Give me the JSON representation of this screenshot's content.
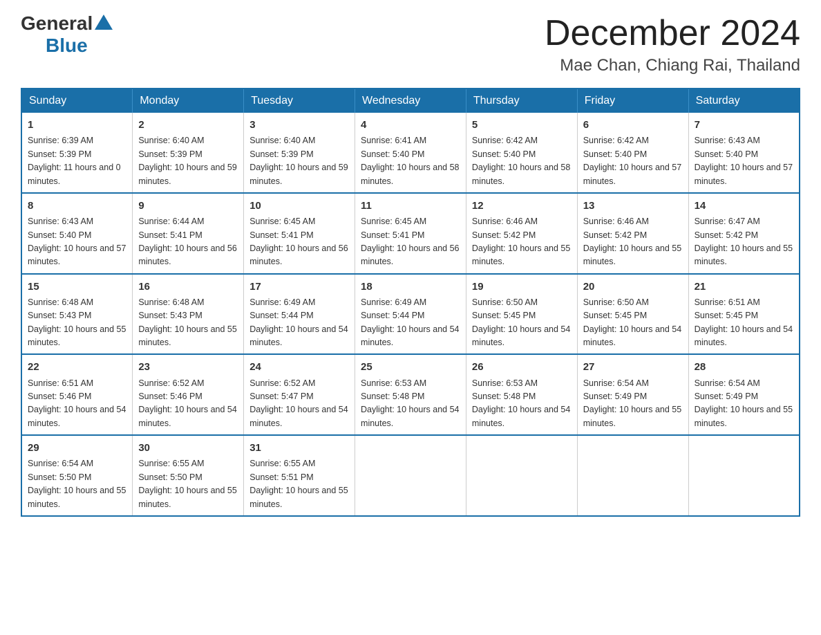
{
  "header": {
    "logo_general": "General",
    "logo_blue": "Blue",
    "month_title": "December 2024",
    "location": "Mae Chan, Chiang Rai, Thailand"
  },
  "weekdays": [
    "Sunday",
    "Monday",
    "Tuesday",
    "Wednesday",
    "Thursday",
    "Friday",
    "Saturday"
  ],
  "weeks": [
    [
      {
        "day": "1",
        "sunrise": "Sunrise: 6:39 AM",
        "sunset": "Sunset: 5:39 PM",
        "daylight": "Daylight: 11 hours and 0 minutes."
      },
      {
        "day": "2",
        "sunrise": "Sunrise: 6:40 AM",
        "sunset": "Sunset: 5:39 PM",
        "daylight": "Daylight: 10 hours and 59 minutes."
      },
      {
        "day": "3",
        "sunrise": "Sunrise: 6:40 AM",
        "sunset": "Sunset: 5:39 PM",
        "daylight": "Daylight: 10 hours and 59 minutes."
      },
      {
        "day": "4",
        "sunrise": "Sunrise: 6:41 AM",
        "sunset": "Sunset: 5:40 PM",
        "daylight": "Daylight: 10 hours and 58 minutes."
      },
      {
        "day": "5",
        "sunrise": "Sunrise: 6:42 AM",
        "sunset": "Sunset: 5:40 PM",
        "daylight": "Daylight: 10 hours and 58 minutes."
      },
      {
        "day": "6",
        "sunrise": "Sunrise: 6:42 AM",
        "sunset": "Sunset: 5:40 PM",
        "daylight": "Daylight: 10 hours and 57 minutes."
      },
      {
        "day": "7",
        "sunrise": "Sunrise: 6:43 AM",
        "sunset": "Sunset: 5:40 PM",
        "daylight": "Daylight: 10 hours and 57 minutes."
      }
    ],
    [
      {
        "day": "8",
        "sunrise": "Sunrise: 6:43 AM",
        "sunset": "Sunset: 5:40 PM",
        "daylight": "Daylight: 10 hours and 57 minutes."
      },
      {
        "day": "9",
        "sunrise": "Sunrise: 6:44 AM",
        "sunset": "Sunset: 5:41 PM",
        "daylight": "Daylight: 10 hours and 56 minutes."
      },
      {
        "day": "10",
        "sunrise": "Sunrise: 6:45 AM",
        "sunset": "Sunset: 5:41 PM",
        "daylight": "Daylight: 10 hours and 56 minutes."
      },
      {
        "day": "11",
        "sunrise": "Sunrise: 6:45 AM",
        "sunset": "Sunset: 5:41 PM",
        "daylight": "Daylight: 10 hours and 56 minutes."
      },
      {
        "day": "12",
        "sunrise": "Sunrise: 6:46 AM",
        "sunset": "Sunset: 5:42 PM",
        "daylight": "Daylight: 10 hours and 55 minutes."
      },
      {
        "day": "13",
        "sunrise": "Sunrise: 6:46 AM",
        "sunset": "Sunset: 5:42 PM",
        "daylight": "Daylight: 10 hours and 55 minutes."
      },
      {
        "day": "14",
        "sunrise": "Sunrise: 6:47 AM",
        "sunset": "Sunset: 5:42 PM",
        "daylight": "Daylight: 10 hours and 55 minutes."
      }
    ],
    [
      {
        "day": "15",
        "sunrise": "Sunrise: 6:48 AM",
        "sunset": "Sunset: 5:43 PM",
        "daylight": "Daylight: 10 hours and 55 minutes."
      },
      {
        "day": "16",
        "sunrise": "Sunrise: 6:48 AM",
        "sunset": "Sunset: 5:43 PM",
        "daylight": "Daylight: 10 hours and 55 minutes."
      },
      {
        "day": "17",
        "sunrise": "Sunrise: 6:49 AM",
        "sunset": "Sunset: 5:44 PM",
        "daylight": "Daylight: 10 hours and 54 minutes."
      },
      {
        "day": "18",
        "sunrise": "Sunrise: 6:49 AM",
        "sunset": "Sunset: 5:44 PM",
        "daylight": "Daylight: 10 hours and 54 minutes."
      },
      {
        "day": "19",
        "sunrise": "Sunrise: 6:50 AM",
        "sunset": "Sunset: 5:45 PM",
        "daylight": "Daylight: 10 hours and 54 minutes."
      },
      {
        "day": "20",
        "sunrise": "Sunrise: 6:50 AM",
        "sunset": "Sunset: 5:45 PM",
        "daylight": "Daylight: 10 hours and 54 minutes."
      },
      {
        "day": "21",
        "sunrise": "Sunrise: 6:51 AM",
        "sunset": "Sunset: 5:45 PM",
        "daylight": "Daylight: 10 hours and 54 minutes."
      }
    ],
    [
      {
        "day": "22",
        "sunrise": "Sunrise: 6:51 AM",
        "sunset": "Sunset: 5:46 PM",
        "daylight": "Daylight: 10 hours and 54 minutes."
      },
      {
        "day": "23",
        "sunrise": "Sunrise: 6:52 AM",
        "sunset": "Sunset: 5:46 PM",
        "daylight": "Daylight: 10 hours and 54 minutes."
      },
      {
        "day": "24",
        "sunrise": "Sunrise: 6:52 AM",
        "sunset": "Sunset: 5:47 PM",
        "daylight": "Daylight: 10 hours and 54 minutes."
      },
      {
        "day": "25",
        "sunrise": "Sunrise: 6:53 AM",
        "sunset": "Sunset: 5:48 PM",
        "daylight": "Daylight: 10 hours and 54 minutes."
      },
      {
        "day": "26",
        "sunrise": "Sunrise: 6:53 AM",
        "sunset": "Sunset: 5:48 PM",
        "daylight": "Daylight: 10 hours and 54 minutes."
      },
      {
        "day": "27",
        "sunrise": "Sunrise: 6:54 AM",
        "sunset": "Sunset: 5:49 PM",
        "daylight": "Daylight: 10 hours and 55 minutes."
      },
      {
        "day": "28",
        "sunrise": "Sunrise: 6:54 AM",
        "sunset": "Sunset: 5:49 PM",
        "daylight": "Daylight: 10 hours and 55 minutes."
      }
    ],
    [
      {
        "day": "29",
        "sunrise": "Sunrise: 6:54 AM",
        "sunset": "Sunset: 5:50 PM",
        "daylight": "Daylight: 10 hours and 55 minutes."
      },
      {
        "day": "30",
        "sunrise": "Sunrise: 6:55 AM",
        "sunset": "Sunset: 5:50 PM",
        "daylight": "Daylight: 10 hours and 55 minutes."
      },
      {
        "day": "31",
        "sunrise": "Sunrise: 6:55 AM",
        "sunset": "Sunset: 5:51 PM",
        "daylight": "Daylight: 10 hours and 55 minutes."
      },
      null,
      null,
      null,
      null
    ]
  ]
}
